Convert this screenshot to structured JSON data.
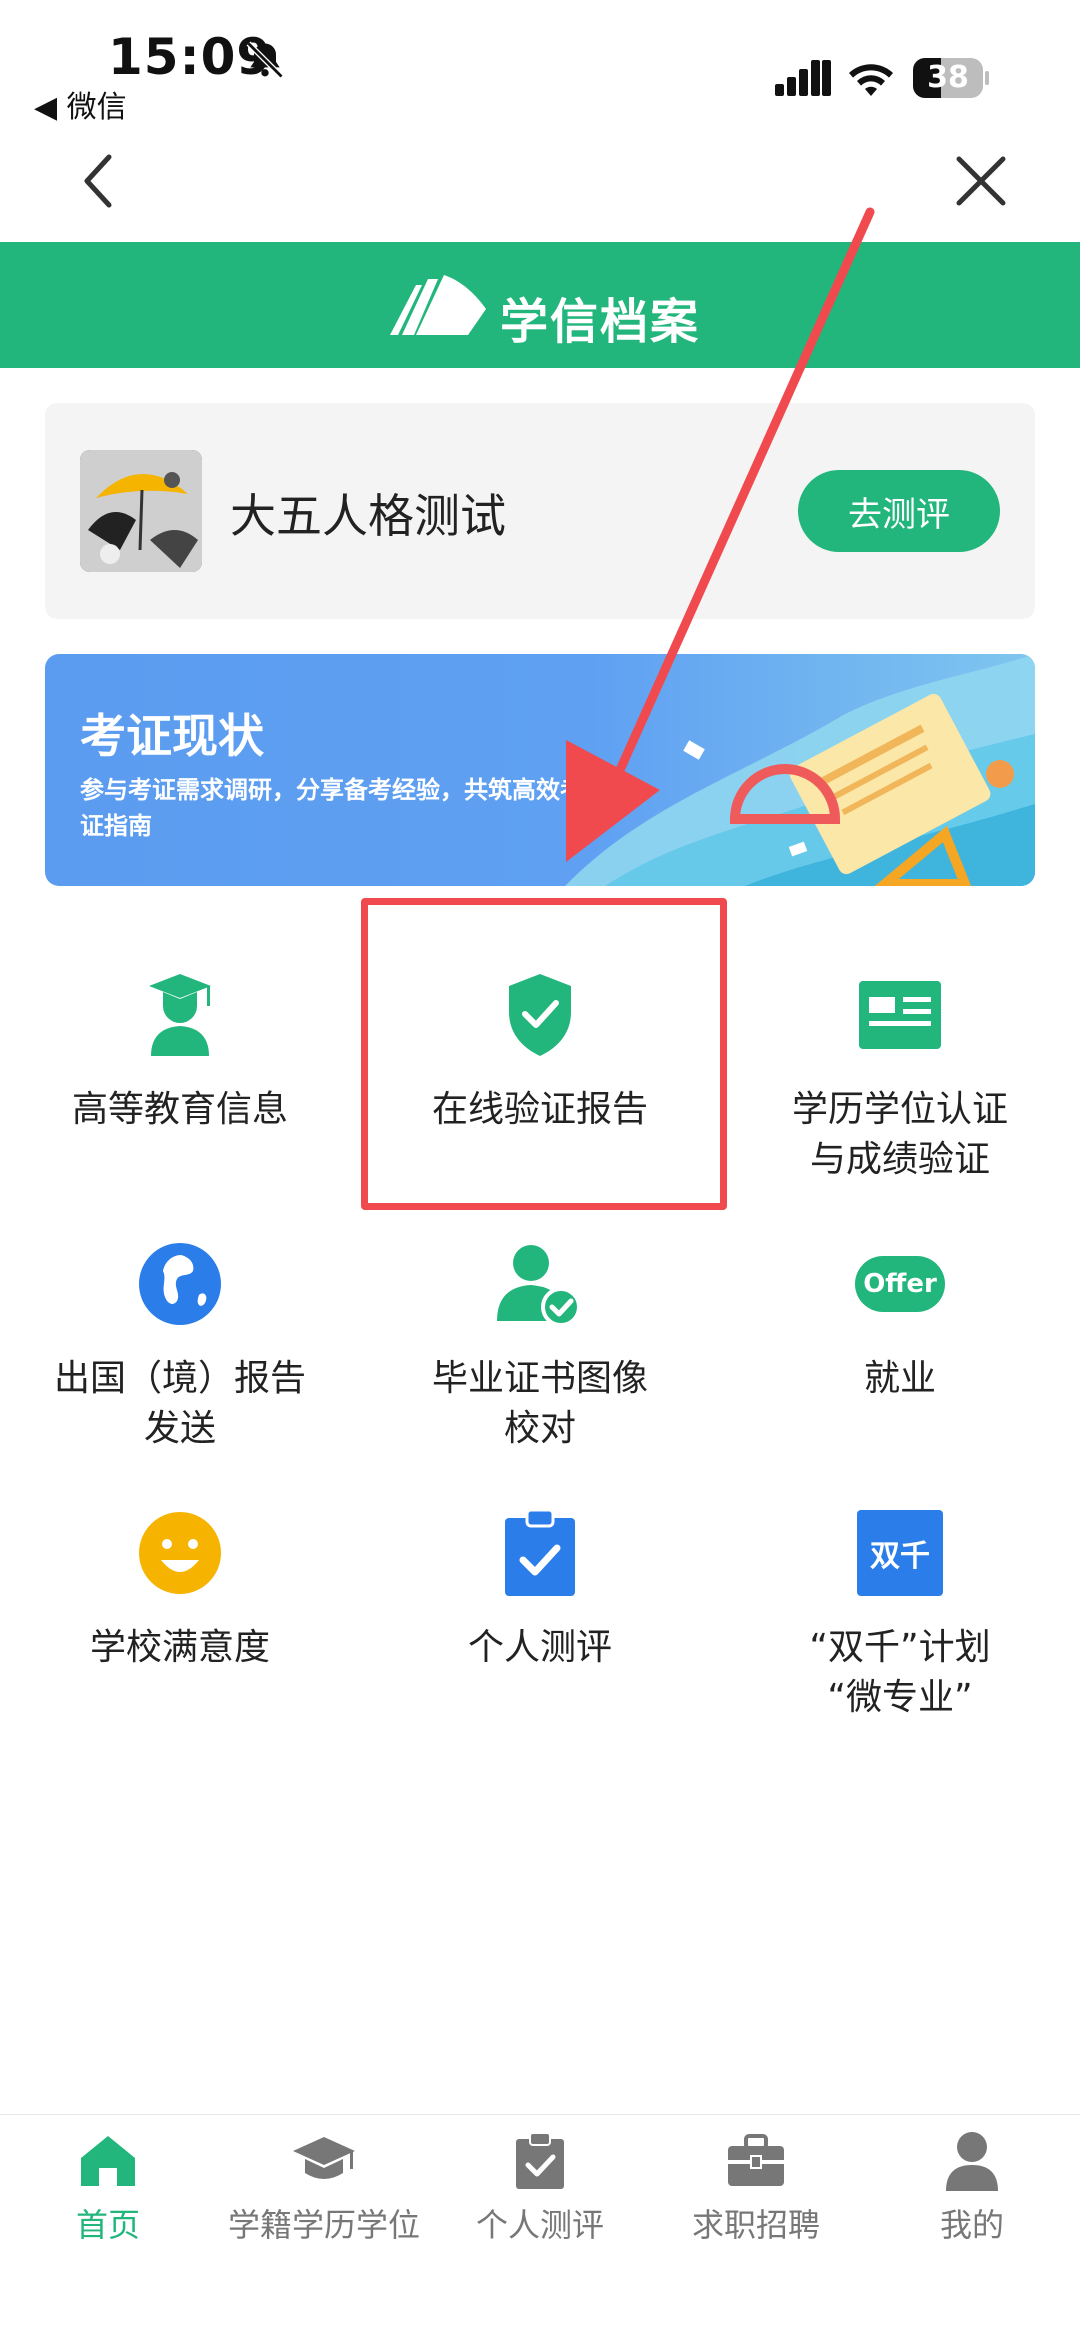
{
  "status_bar": {
    "time": "15:09",
    "back_label": "◀ 微信",
    "battery": "38"
  },
  "header": {
    "title": "学信档案"
  },
  "promo": {
    "title": "大五人格测试",
    "button": "去测评"
  },
  "banner": {
    "title": "考证现状",
    "desc": "参与考证需求调研，分享备考经验，共筑高效考证指南"
  },
  "grid": [
    {
      "label": "高等教育信息",
      "icon": "graduate-icon"
    },
    {
      "label": "在线验证报告",
      "icon": "shield-check-icon"
    },
    {
      "label": "学历学位认证\n与成绩验证",
      "icon": "id-card-icon"
    },
    {
      "label": "出国（境）报告\n发送",
      "icon": "globe-icon"
    },
    {
      "label": "毕业证书图像\n校对",
      "icon": "person-check-icon"
    },
    {
      "label": "就业",
      "icon": "offer-icon",
      "badge": "Offer"
    },
    {
      "label": "学校满意度",
      "icon": "smile-icon"
    },
    {
      "label": "个人测评",
      "icon": "clipboard-check-icon"
    },
    {
      "label": "“双千”计划\n“微专业”",
      "icon": "shuangqian-icon",
      "badge": "双千"
    }
  ],
  "tabs": [
    {
      "label": "首页",
      "icon": "home-icon",
      "active": true
    },
    {
      "label": "学籍学历学位",
      "icon": "graduation-cap-icon"
    },
    {
      "label": "个人测评",
      "icon": "clipboard-icon"
    },
    {
      "label": "求职招聘",
      "icon": "briefcase-icon"
    },
    {
      "label": "我的",
      "icon": "user-icon"
    }
  ],
  "colors": {
    "brand_green": "#22b67c",
    "highlight_red": "#f04a4e",
    "banner_blue": "#5b9cf0"
  }
}
